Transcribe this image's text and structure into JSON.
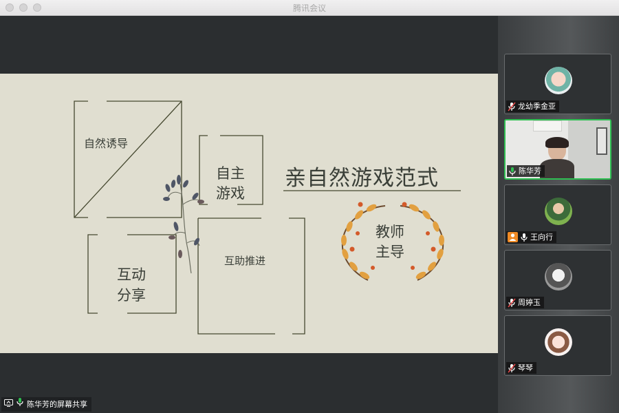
{
  "window": {
    "title": "腾讯会议"
  },
  "slide": {
    "title": "亲自然游戏范式",
    "boxes": {
      "natural_guidance": "自然诱导",
      "autonomous_play_1": "自主",
      "autonomous_play_2": "游戏",
      "mutual_help": "互助推进",
      "interaction_1": "互动",
      "interaction_2": "分享",
      "teacher_1": "教师",
      "teacher_2": "主导"
    }
  },
  "participants": [
    {
      "name": "龙幼季金亚",
      "muted": true,
      "speaking": false
    },
    {
      "name": "陈华芳",
      "muted": false,
      "speaking": true
    },
    {
      "name": "王向行",
      "muted": false,
      "speaking": false,
      "host": true
    },
    {
      "name": "周婷玉",
      "muted": true,
      "speaking": false
    },
    {
      "name": "琴琴",
      "muted": true,
      "speaking": false
    }
  ],
  "share_bar": {
    "label": "陈华芳的屏幕共享"
  },
  "colors": {
    "active_border": "#2fbf52",
    "slide_bg": "#e0ded0",
    "host_badge": "#f08a24"
  }
}
